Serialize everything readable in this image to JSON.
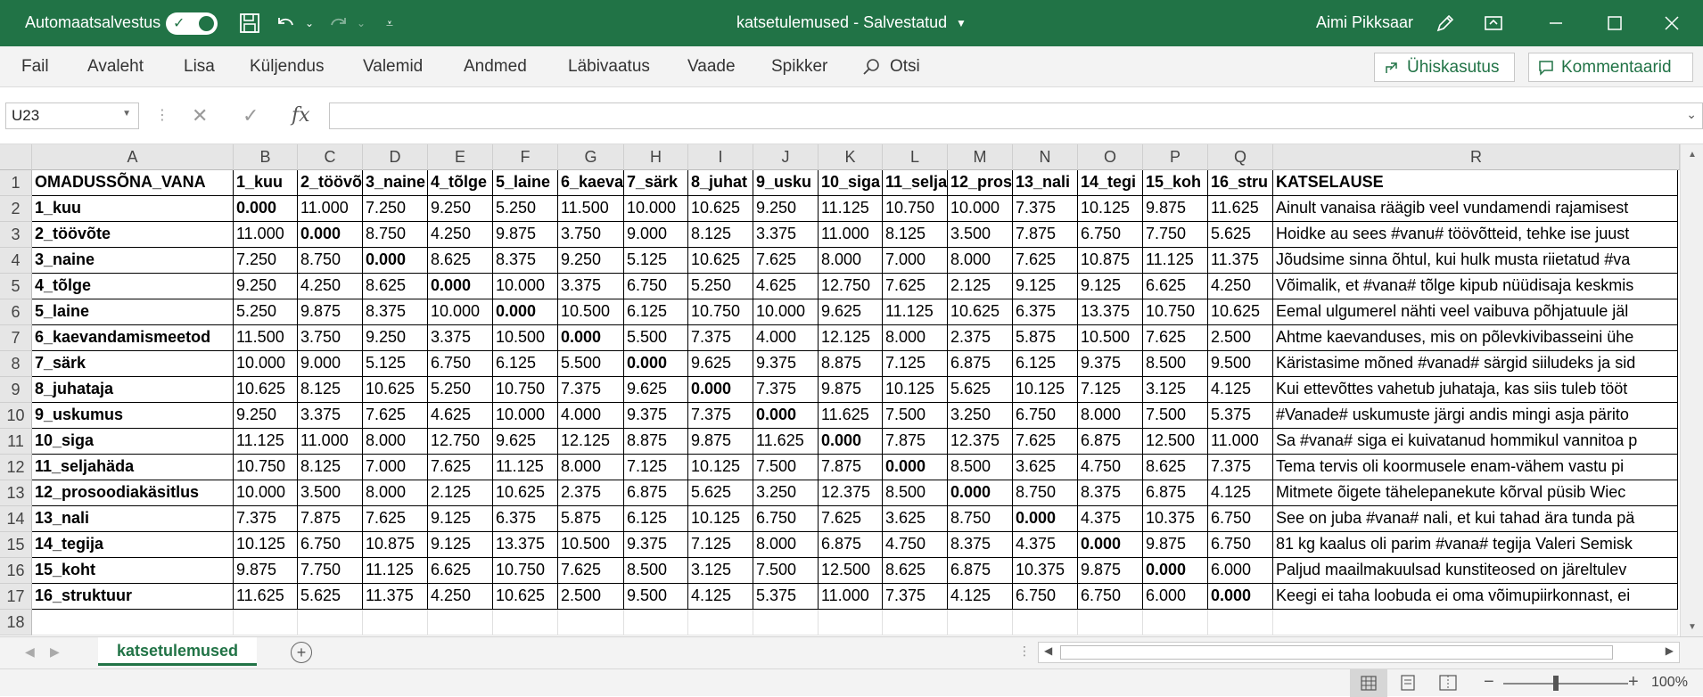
{
  "titlebar": {
    "autosave_label": "Automaatsalvestus",
    "document_title": "katsetulemused  -  Salvestatud",
    "user_name": "Aimi Pikksaar"
  },
  "menu": {
    "items": [
      "Fail",
      "Avaleht",
      "Lisa",
      "Küljendus",
      "Valemid",
      "Andmed",
      "Läbivaatus",
      "Vaade",
      "Spikker"
    ],
    "search_label": "Otsi",
    "share_label": "Ühiskasutus",
    "comments_label": "Kommentaarid"
  },
  "formula_bar": {
    "name_box": "U23",
    "fx_label": "fx",
    "formula": ""
  },
  "sheet": {
    "columns": [
      "A",
      "B",
      "C",
      "D",
      "E",
      "F",
      "G",
      "H",
      "I",
      "J",
      "K",
      "L",
      "M",
      "N",
      "O",
      "P",
      "Q",
      "R"
    ],
    "rows": [
      [
        "OMADUSSÕNA_VANA",
        "1_kuu",
        "2_töövõ",
        "3_naine",
        "4_tõlge",
        "5_laine",
        "6_kaeva",
        "7_särk",
        "8_juhat",
        "9_usku",
        "10_siga",
        "11_selja",
        "12_pros",
        "13_nali",
        "14_tegi",
        "15_koh",
        "16_stru",
        "KATSELAUSE"
      ],
      [
        "1_kuu",
        "0.000",
        "11.000",
        "7.250",
        "9.250",
        "5.250",
        "11.500",
        "10.000",
        "10.625",
        "9.250",
        "11.125",
        "10.750",
        "10.000",
        "7.375",
        "10.125",
        "9.875",
        "11.625",
        "Ainult vanaisa räägib veel vundamendi rajamisest"
      ],
      [
        "2_töövõte",
        "11.000",
        "0.000",
        "8.750",
        "4.250",
        "9.875",
        "3.750",
        "9.000",
        "8.125",
        "3.375",
        "11.000",
        "8.125",
        "3.500",
        "7.875",
        "6.750",
        "7.750",
        "5.625",
        "Hoidke au sees #vanu# töövõtteid, tehke ise juust"
      ],
      [
        "3_naine",
        "7.250",
        "8.750",
        "0.000",
        "8.625",
        "8.375",
        "9.250",
        "5.125",
        "10.625",
        "7.625",
        "8.000",
        "7.000",
        "8.000",
        "7.625",
        "10.875",
        "11.125",
        "11.375",
        "Jõudsime sinna õhtul, kui hulk musta riietatud #va"
      ],
      [
        "4_tõlge",
        "9.250",
        "4.250",
        "8.625",
        "0.000",
        "10.000",
        "3.375",
        "6.750",
        "5.250",
        "4.625",
        "12.750",
        "7.625",
        "2.125",
        "9.125",
        "9.125",
        "6.625",
        "4.250",
        "Võimalik, et #vana# tõlge kipub nüüdisaja keskmis"
      ],
      [
        "5_laine",
        "5.250",
        "9.875",
        "8.375",
        "10.000",
        "0.000",
        "10.500",
        "6.125",
        "10.750",
        "10.000",
        "9.625",
        "11.125",
        "10.625",
        "6.375",
        "13.375",
        "10.750",
        "10.625",
        "Eemal ulgumerel nähti veel vaibuva põhjatuule jäl"
      ],
      [
        "6_kaevandamismeetod",
        "11.500",
        "3.750",
        "9.250",
        "3.375",
        "10.500",
        "0.000",
        "5.500",
        "7.375",
        "4.000",
        "12.125",
        "8.000",
        "2.375",
        "5.875",
        "10.500",
        "7.625",
        "2.500",
        "Ahtme kaevanduses, mis on põlevkivibasseini ühe"
      ],
      [
        "7_särk",
        "10.000",
        "9.000",
        "5.125",
        "6.750",
        "6.125",
        "5.500",
        "0.000",
        "9.625",
        "9.375",
        "8.875",
        "7.125",
        "6.875",
        "6.125",
        "9.375",
        "8.500",
        "9.500",
        "Käristasime mõned #vanad# särgid siiludeks ja sid"
      ],
      [
        "8_juhataja",
        "10.625",
        "8.125",
        "10.625",
        "5.250",
        "10.750",
        "7.375",
        "9.625",
        "0.000",
        "7.375",
        "9.875",
        "10.125",
        "5.625",
        "10.125",
        "7.125",
        "3.125",
        "4.125",
        "Kui ettevõttes vahetub juhataja, kas siis tuleb tööt"
      ],
      [
        "9_uskumus",
        "9.250",
        "3.375",
        "7.625",
        "4.625",
        "10.000",
        "4.000",
        "9.375",
        "7.375",
        "0.000",
        "11.625",
        "7.500",
        "3.250",
        "6.750",
        "8.000",
        "7.500",
        "5.375",
        "#Vanade# uskumuste järgi andis mingi asja pärito"
      ],
      [
        "10_siga",
        "11.125",
        "11.000",
        "8.000",
        "12.750",
        "9.625",
        "12.125",
        "8.875",
        "9.875",
        "11.625",
        "0.000",
        "7.875",
        "12.375",
        "7.625",
        "6.875",
        "12.500",
        "11.000",
        "Sa #vana# siga ei kuivatanud hommikul vannitoa p"
      ],
      [
        "11_seljahäda",
        "10.750",
        "8.125",
        "7.000",
        "7.625",
        "11.125",
        "8.000",
        "7.125",
        "10.125",
        "7.500",
        "7.875",
        "0.000",
        "8.500",
        "3.625",
        "4.750",
        "8.625",
        "7.375",
        "Tema tervis oli koormusele enam-vähem vastu pi"
      ],
      [
        "12_prosoodiakäsitlus",
        "10.000",
        "3.500",
        "8.000",
        "2.125",
        "10.625",
        "2.375",
        "6.875",
        "5.625",
        "3.250",
        "12.375",
        "8.500",
        "0.000",
        "8.750",
        "8.375",
        "6.875",
        "4.125",
        "Mitmete õigete tähelepanekute kõrval püsib Wiec"
      ],
      [
        "13_nali",
        "7.375",
        "7.875",
        "7.625",
        "9.125",
        "6.375",
        "5.875",
        "6.125",
        "10.125",
        "6.750",
        "7.625",
        "3.625",
        "8.750",
        "0.000",
        "4.375",
        "10.375",
        "6.750",
        "See on juba #vana# nali, et kui tahad ära tunda pä"
      ],
      [
        "14_tegija",
        "10.125",
        "6.750",
        "10.875",
        "9.125",
        "13.375",
        "10.500",
        "9.375",
        "7.125",
        "8.000",
        "6.875",
        "4.750",
        "8.375",
        "4.375",
        "0.000",
        "9.875",
        "6.750",
        "81 kg kaalus oli parim #vana# tegija Valeri Semisk"
      ],
      [
        "15_koht",
        "9.875",
        "7.750",
        "11.125",
        "6.625",
        "10.750",
        "7.625",
        "8.500",
        "3.125",
        "7.500",
        "12.500",
        "8.625",
        "6.875",
        "10.375",
        "9.875",
        "0.000",
        "6.000",
        "Paljud maailmakuulsad kunstiteosed on järeltulev"
      ],
      [
        "16_struktuur",
        "11.625",
        "5.625",
        "11.375",
        "4.250",
        "10.625",
        "2.500",
        "9.500",
        "4.125",
        "5.375",
        "11.000",
        "7.375",
        "4.125",
        "6.750",
        "6.750",
        "6.000",
        "0.000",
        "Keegi ei taha loobuda ei oma võimupiirkonnast, ei"
      ]
    ],
    "empty_row_number": "18"
  },
  "sheet_tab": "katsetulemused",
  "status": {
    "zoom": "100%",
    "zoom_minus": "−",
    "zoom_plus": "+"
  },
  "colors": {
    "accent": "#217346",
    "header_bg": "#e6e6e6"
  }
}
